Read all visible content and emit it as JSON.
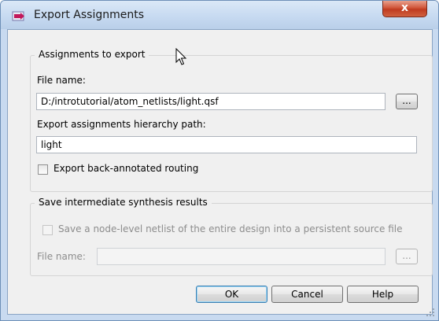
{
  "window": {
    "title": "Export Assignments",
    "close_glyph": "x"
  },
  "export_group": {
    "title": "Assignments to export",
    "file_name_label": "File name:",
    "file_name_value": "D:/introtutorial/atom_netlists/light.qsf",
    "browse_label": "...",
    "hierarchy_label": "Export assignments hierarchy path:",
    "hierarchy_value": "light",
    "routing_checkbox_label": "Export back-annotated routing",
    "routing_checked": false
  },
  "synthesis_group": {
    "title": "Save intermediate synthesis results",
    "netlist_checkbox_label": "Save a node-level netlist of the entire design into a persistent source file",
    "netlist_checked": false,
    "file_name_label": "File name:",
    "file_name_value": "",
    "browse_label": "..."
  },
  "buttons": {
    "ok": "OK",
    "cancel": "Cancel",
    "help": "Help"
  },
  "icons": {
    "app": "export-assignments-icon",
    "cursor": "mouse-pointer-icon",
    "grip": "resize-grip-icon"
  }
}
